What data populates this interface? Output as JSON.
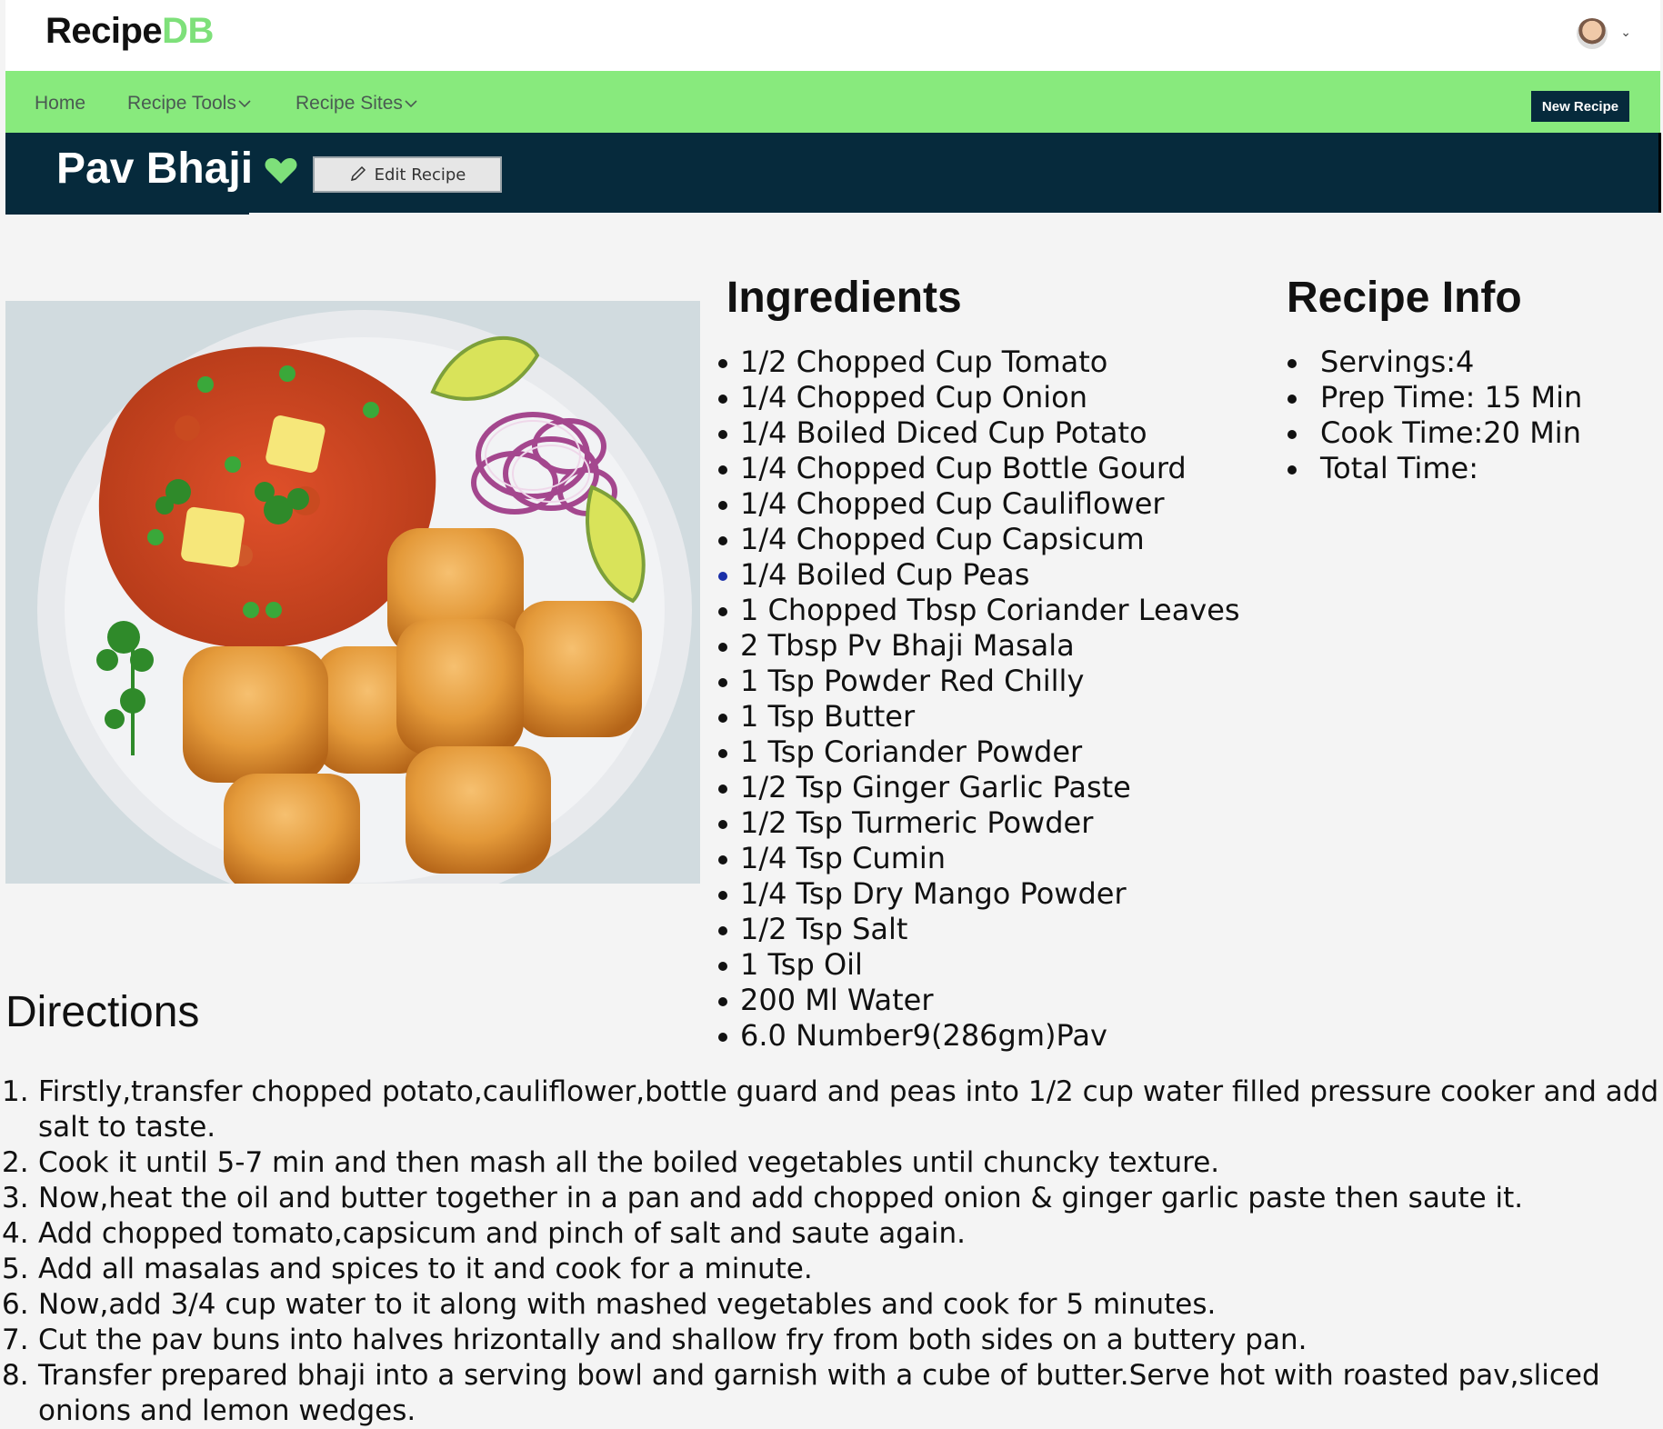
{
  "header": {
    "logo_main": "Recipe",
    "logo_accent": "DB",
    "user_caret": "⌄"
  },
  "nav": {
    "home": "Home",
    "recipe_tools": "Recipe Tools",
    "recipe_sites": "Recipe Sites",
    "new_recipe": "New Recipe"
  },
  "recipe": {
    "title": "Pav Bhaji",
    "edit_label": "Edit Recipe"
  },
  "ingredients": {
    "heading": "Ingredients",
    "items": [
      "1/2 Chopped Cup Tomato",
      "1/4 Chopped Cup Onion",
      "1/4 Boiled Diced Cup Potato",
      "1/4 Chopped Cup Bottle Gourd",
      "1/4 Chopped Cup Cauliflower",
      "1/4 Chopped Cup Capsicum",
      "1/4 Boiled Cup Peas",
      "1 Chopped Tbsp Coriander Leaves",
      "2 Tbsp Pv Bhaji Masala",
      "1 Tsp Powder Red Chilly",
      "1 Tsp Butter",
      "1 Tsp Coriander Powder",
      "1/2 Tsp Ginger Garlic Paste",
      "1/2 Tsp Turmeric Powder",
      "1/4 Tsp Cumin",
      "1/4 Tsp Dry Mango Powder",
      "1/2 Tsp Salt",
      "1 Tsp Oil",
      "200 Ml Water",
      "6.0 Number9(286gm)Pav"
    ]
  },
  "info": {
    "heading": "Recipe Info",
    "items": [
      "Servings:4",
      "Prep Time: 15 Min",
      "Cook Time:20 Min",
      "Total Time:"
    ]
  },
  "directions": {
    "heading": "Directions",
    "steps": [
      "Firstly,transfer chopped potato,cauliflower,bottle guard and peas into 1/2 cup water filled pressure cooker and add salt to taste.",
      "Cook it until 5-7 min and then mash all the boiled vegetables until chuncky texture.",
      "Now,heat the oil and butter together in a pan and add chopped onion & ginger garlic paste then saute it.",
      "Add chopped tomato,capsicum and pinch of salt and saute again.",
      "Add all masalas and spices to it and cook for a minute.",
      "Now,add 3/4 cup water to it along with mashed vegetables and cook for 5 minutes.",
      "Cut the pav buns into halves hrizontally and shallow fry from both sides on a buttery pan.",
      "Transfer prepared bhaji into a serving bowl and garnish with a cube of butter.Serve hot with roasted pav,sliced onions and lemon wedges."
    ]
  },
  "colors": {
    "nav_green": "#88ea7d",
    "title_band": "#062a3c",
    "logo_accent": "#7ee07a",
    "heart": "#7ee07a"
  }
}
